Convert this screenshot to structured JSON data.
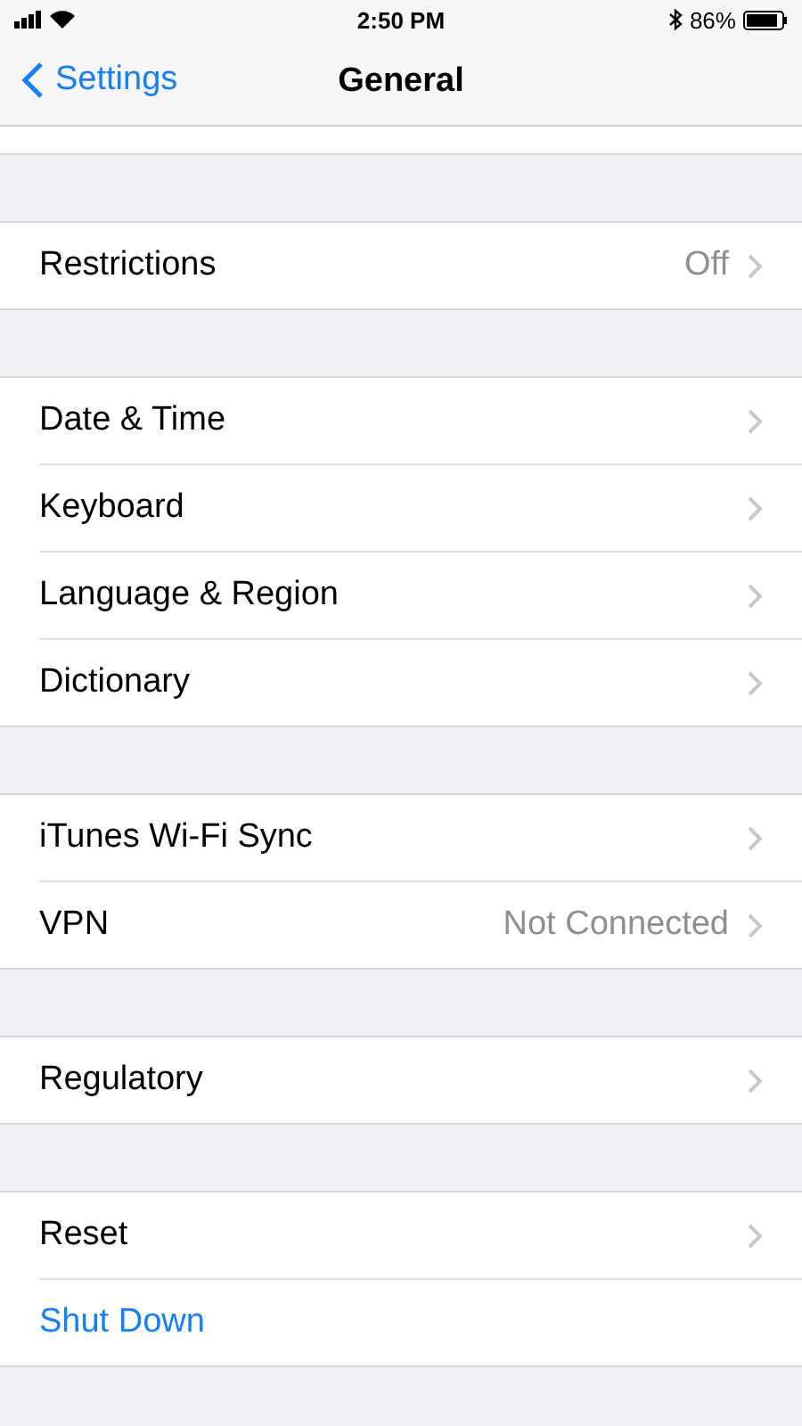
{
  "status_bar": {
    "time": "2:50 PM",
    "battery": "86%"
  },
  "nav_bar": {
    "back": "Settings",
    "title": "General"
  },
  "groups": [
    {
      "rows": [
        {
          "kind": "nav",
          "label": "Restrictions",
          "value": "Off"
        }
      ]
    },
    {
      "rows": [
        {
          "kind": "nav",
          "label": "Date & Time"
        },
        {
          "kind": "nav",
          "label": "Keyboard"
        },
        {
          "kind": "nav",
          "label": "Language & Region"
        },
        {
          "kind": "nav",
          "label": "Dictionary"
        }
      ]
    },
    {
      "rows": [
        {
          "kind": "nav",
          "label": "iTunes Wi-Fi Sync"
        },
        {
          "kind": "nav",
          "label": "VPN",
          "value": "Not Connected"
        }
      ]
    },
    {
      "rows": [
        {
          "kind": "nav",
          "label": "Regulatory"
        }
      ]
    },
    {
      "rows": [
        {
          "kind": "nav",
          "label": "Reset"
        },
        {
          "kind": "action",
          "label": "Shut Down"
        }
      ]
    }
  ]
}
